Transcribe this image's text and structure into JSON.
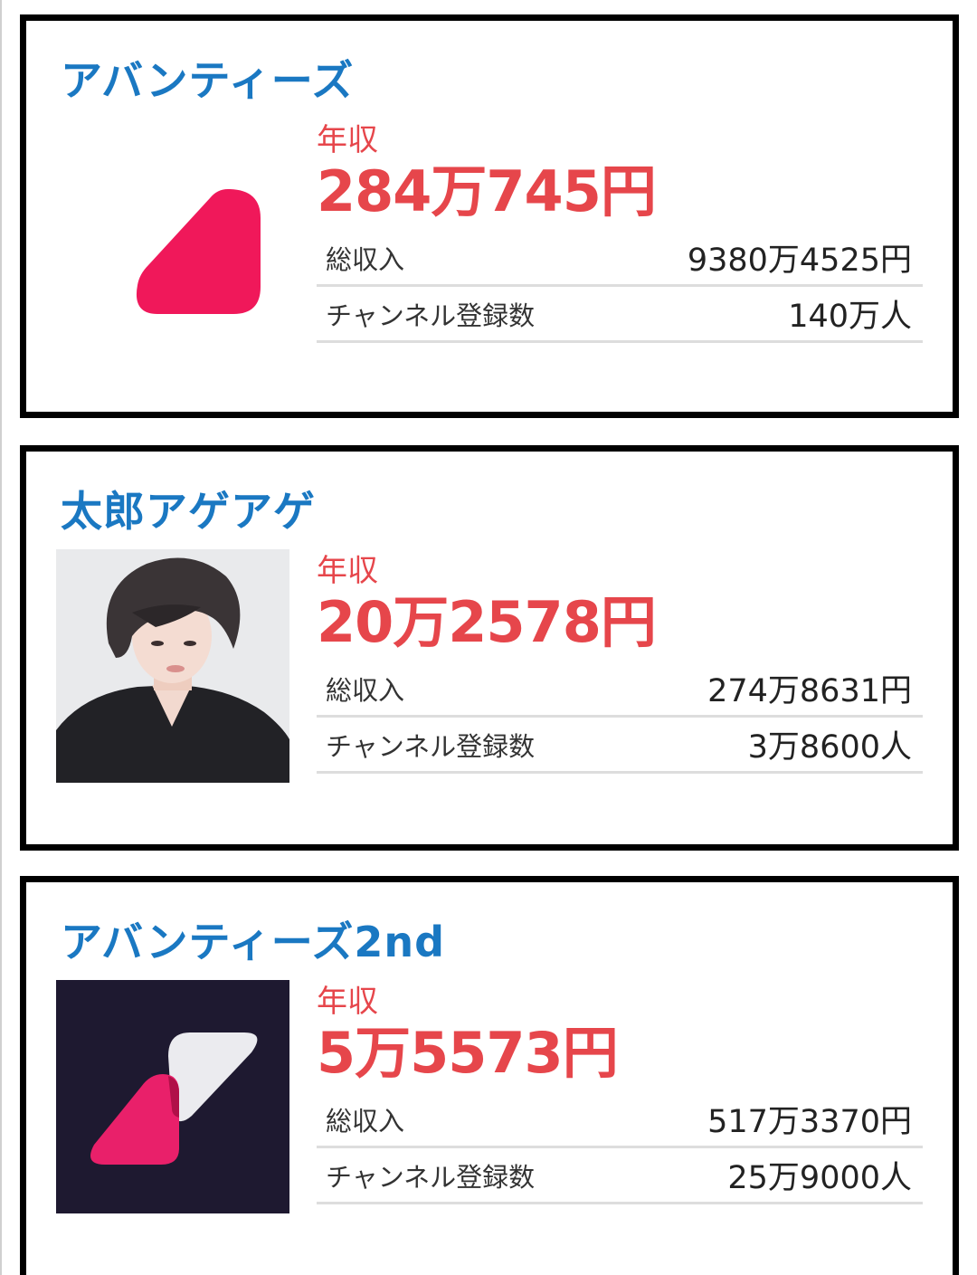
{
  "channels": [
    {
      "name": "アバンティーズ",
      "thumbnail": "avanties-logo",
      "income_label": "年収",
      "income_value": "284万745円",
      "total_label": "総収入",
      "total_value": "9380万4525円",
      "subs_label": "チャンネル登録数",
      "subs_value": "140万人"
    },
    {
      "name": "太郎アゲアゲ",
      "thumbnail": "profile-photo",
      "income_label": "年収",
      "income_value": "20万2578円",
      "total_label": "総収入",
      "total_value": "274万8631円",
      "subs_label": "チャンネル登録数",
      "subs_value": "3万8600人"
    },
    {
      "name": "アバンティーズ2nd",
      "thumbnail": "avanties-2nd-logo",
      "income_label": "年収",
      "income_value": "5万5573円",
      "total_label": "総収入",
      "total_value": "517万3370円",
      "subs_label": "チャンネル登録数",
      "subs_value": "25万9000人"
    }
  ],
  "colors": {
    "title": "#1a78c2",
    "income": "#e6464b",
    "logo_pink": "#f0185a",
    "logo_dark_bg": "#1e1930"
  }
}
